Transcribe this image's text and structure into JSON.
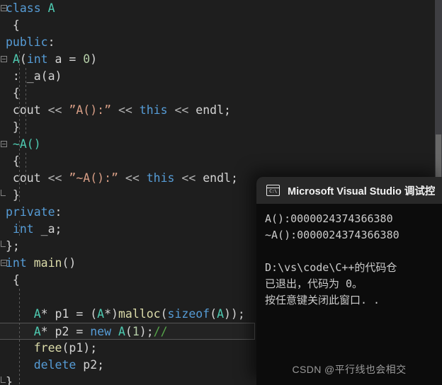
{
  "editor": {
    "name": "visual-studio-code-editor",
    "background": "#1e1e1e",
    "current_line_index": 16,
    "lines": [
      {
        "tokens": [
          {
            "t": "class",
            "c": "kw"
          },
          {
            "t": " ",
            "c": "plain"
          },
          {
            "t": "A",
            "c": "type"
          }
        ],
        "fold": "open"
      },
      {
        "tokens": [
          {
            "t": " {",
            "c": "plain"
          }
        ]
      },
      {
        "tokens": [
          {
            "t": "public",
            "c": "kw"
          },
          {
            "t": ":",
            "c": "plain"
          }
        ]
      },
      {
        "tokens": [
          {
            "t": " A",
            "c": "type"
          },
          {
            "t": "(",
            "c": "plain"
          },
          {
            "t": "int",
            "c": "kw"
          },
          {
            "t": " a = ",
            "c": "plain"
          },
          {
            "t": "0",
            "c": "num"
          },
          {
            "t": ")",
            "c": "plain"
          }
        ],
        "fold": "open"
      },
      {
        "tokens": [
          {
            "t": " : _a(a)",
            "c": "plain"
          }
        ]
      },
      {
        "tokens": [
          {
            "t": " {",
            "c": "plain"
          }
        ]
      },
      {
        "tokens": [
          {
            "t": " cout ",
            "c": "plain"
          },
          {
            "t": "<<",
            "c": "op"
          },
          {
            "t": " ",
            "c": "plain"
          },
          {
            "t": "”A():”",
            "c": "str"
          },
          {
            "t": " ",
            "c": "plain"
          },
          {
            "t": "<<",
            "c": "op"
          },
          {
            "t": " ",
            "c": "plain"
          },
          {
            "t": "this",
            "c": "kw"
          },
          {
            "t": " ",
            "c": "plain"
          },
          {
            "t": "<<",
            "c": "op"
          },
          {
            "t": " endl;",
            "c": "plain"
          }
        ]
      },
      {
        "tokens": [
          {
            "t": " }",
            "c": "plain"
          }
        ]
      },
      {
        "tokens": [
          {
            "t": " ~A()",
            "c": "type"
          }
        ],
        "fold": "open"
      },
      {
        "tokens": [
          {
            "t": " {",
            "c": "plain"
          }
        ]
      },
      {
        "tokens": [
          {
            "t": " cout ",
            "c": "plain"
          },
          {
            "t": "<<",
            "c": "op"
          },
          {
            "t": " ",
            "c": "plain"
          },
          {
            "t": "”~A():”",
            "c": "str"
          },
          {
            "t": " ",
            "c": "plain"
          },
          {
            "t": "<<",
            "c": "op"
          },
          {
            "t": " ",
            "c": "plain"
          },
          {
            "t": "this",
            "c": "kw"
          },
          {
            "t": " ",
            "c": "plain"
          },
          {
            "t": "<<",
            "c": "op"
          },
          {
            "t": " endl;",
            "c": "plain"
          }
        ]
      },
      {
        "tokens": [
          {
            "t": " }",
            "c": "plain"
          }
        ],
        "fold": "end"
      },
      {
        "tokens": [
          {
            "t": "private",
            "c": "kw"
          },
          {
            "t": ":",
            "c": "plain"
          }
        ]
      },
      {
        "tokens": [
          {
            "t": " ",
            "c": "plain"
          },
          {
            "t": "int",
            "c": "kw"
          },
          {
            "t": " _a;",
            "c": "plain"
          }
        ]
      },
      {
        "tokens": [
          {
            "t": "};",
            "c": "plain"
          }
        ],
        "fold": "end"
      },
      {
        "tokens": [
          {
            "t": "int",
            "c": "kw"
          },
          {
            "t": " ",
            "c": "plain"
          },
          {
            "t": "main",
            "c": "fn"
          },
          {
            "t": "()",
            "c": "plain"
          }
        ],
        "fold": "open"
      },
      {
        "tokens": [
          {
            "t": " {",
            "c": "plain"
          }
        ]
      },
      {
        "tokens": [
          {
            "t": "",
            "c": "plain"
          }
        ]
      },
      {
        "tokens": [
          {
            "t": "    A",
            "c": "type"
          },
          {
            "t": "* p1 = (",
            "c": "plain"
          },
          {
            "t": "A",
            "c": "type"
          },
          {
            "t": "*)",
            "c": "plain"
          },
          {
            "t": "malloc",
            "c": "fn"
          },
          {
            "t": "(",
            "c": "plain"
          },
          {
            "t": "sizeof",
            "c": "kw"
          },
          {
            "t": "(",
            "c": "plain"
          },
          {
            "t": "A",
            "c": "type"
          },
          {
            "t": "));",
            "c": "plain"
          }
        ]
      },
      {
        "tokens": [
          {
            "t": "    A",
            "c": "type"
          },
          {
            "t": "* p2 = ",
            "c": "plain"
          },
          {
            "t": "new",
            "c": "kw"
          },
          {
            "t": " ",
            "c": "plain"
          },
          {
            "t": "A",
            "c": "type"
          },
          {
            "t": "(",
            "c": "plain"
          },
          {
            "t": "1",
            "c": "num"
          },
          {
            "t": ");",
            "c": "plain"
          },
          {
            "t": "//",
            "c": "cmt"
          }
        ],
        "current": true
      },
      {
        "tokens": [
          {
            "t": "    ",
            "c": "plain"
          },
          {
            "t": "free",
            "c": "fn"
          },
          {
            "t": "(p1);",
            "c": "plain"
          }
        ]
      },
      {
        "tokens": [
          {
            "t": "    ",
            "c": "plain"
          },
          {
            "t": "delete",
            "c": "kw"
          },
          {
            "t": " p2;",
            "c": "plain"
          }
        ]
      },
      {
        "tokens": [
          {
            "t": "}",
            "c": "plain"
          }
        ],
        "fold": "end"
      }
    ]
  },
  "console": {
    "title": "Microsoft Visual Studio 调试控",
    "icon": "console-cmd-icon",
    "output_lines": [
      "A():0000024374366380",
      "~A():0000024374366380",
      "",
      "D:\\vs\\code\\C++的代码仓",
      "已退出，代码为 0。",
      "按任意键关闭此窗口. ."
    ]
  },
  "watermark": {
    "text": "CSDN @平行线也会相交"
  }
}
